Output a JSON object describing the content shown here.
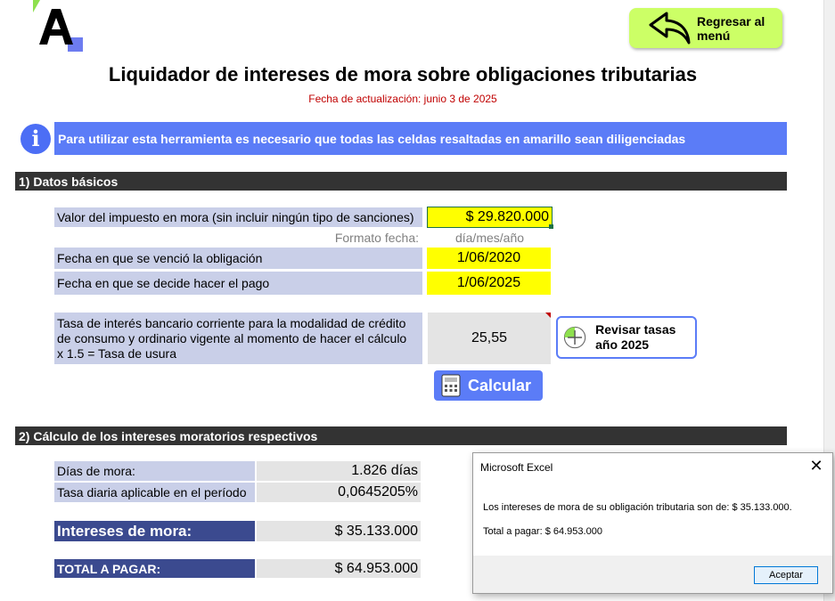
{
  "header": {
    "back_button_label": "Regresar al menú",
    "title": "Liquidador de intereses de mora sobre obligaciones tributarias",
    "updated": "Fecha de actualización: junio 3 de 2025"
  },
  "info": {
    "text": "Para utilizar esta herramienta es necesario que todas las celdas resaltadas en amarillo sean diligenciadas"
  },
  "section1": {
    "title": "1) Datos básicos",
    "tax_label": "Valor del impuesto en mora (sin incluir ningún tipo de sanciones)",
    "tax_value": "$ 29.820.000",
    "date_format_label": "Formato fecha:",
    "date_format_value": "día/mes/año",
    "due_label": "Fecha en que se venció la obligación",
    "due_value": "1/06/2020",
    "pay_label": "Fecha en que se decide hacer el pago",
    "pay_value": "1/06/2025",
    "rate_label": "Tasa de interés bancario corriente para la modalidad de crédito de consumo y ordinario vigente al momento de hacer el cálculo x 1.5 = Tasa de usura",
    "rate_value": "25,55",
    "rate_button": "Revisar tasas año 2025",
    "calc_button": "Calcular"
  },
  "section2": {
    "title": "2) Cálculo de los intereses moratorios respectivos",
    "days_label": "Días de mora:",
    "days_value": "1.826 días",
    "daily_label": "Tasa diaria aplicable en el período",
    "daily_value": "0,0645205%",
    "interest_label": "Intereses de mora:",
    "interest_value": "$ 35.133.000",
    "total_label": "TOTAL A PAGAR:",
    "total_value": "$ 64.953.000"
  },
  "dialog": {
    "title": "Microsoft Excel",
    "message1": "Los intereses de mora de su obligación tributaria son de: $ 35.133.000.",
    "message2": "Total a pagar: $ 64.953.000",
    "ok": "Aceptar"
  },
  "colors": {
    "accent_blue": "#5b7cf7",
    "input_yellow": "#ffff00",
    "label_lavender": "#c9cfe8",
    "back_green": "#ccff66",
    "section_dark": "#333333",
    "result_navy": "#3b4a8f"
  }
}
